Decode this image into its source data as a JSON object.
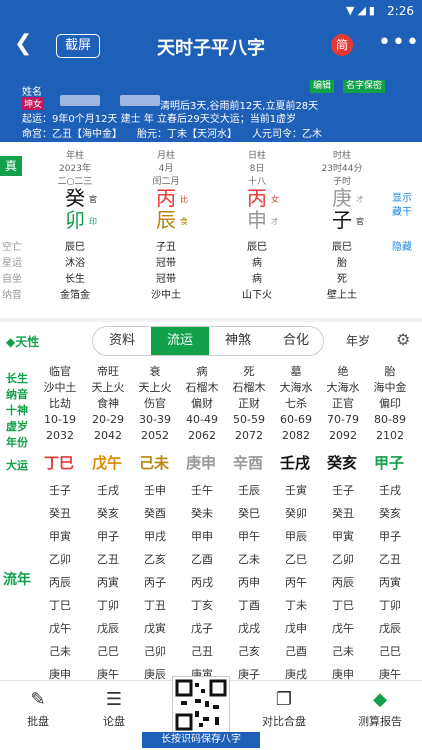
{
  "status": {
    "time": "2:26",
    "icons": "▼◢▮"
  },
  "appbar": {
    "title": "天时子平八字",
    "screenshot_btn": "截屏",
    "simplified_btn": "简",
    "more": "•••",
    "back": "❮"
  },
  "info": {
    "name_label": "姓名",
    "gender_badge": "坤女",
    "line1_right": "清明后3天,谷雨前12天,立夏前28天",
    "edit_btn": "编辑",
    "privacy_btn": "名字保密",
    "line2": "起运：9年0个月12天 建士 年 立春后29天交大运；当前1虚岁",
    "line3": "命宫：乙丑【海中金】　　胎元：丁未【天河水】　　人元司令：乙木"
  },
  "pillars": {
    "zhen": "真",
    "cols": [
      {
        "head": "年柱",
        "sub1": "2023年",
        "sub2": "二○二三",
        "gan": "癸",
        "gan_tag": "官",
        "gan_color": "#111111",
        "zhi": "卯",
        "zhi_tag": "印",
        "zhi_color": "#12a04a"
      },
      {
        "head": "月柱",
        "sub1": "4月",
        "sub2": "闰二月",
        "gan": "丙",
        "gan_tag": "比",
        "gan_color": "#e53935",
        "zhi": "辰",
        "zhi_tag": "食",
        "zhi_color": "#b8860b"
      },
      {
        "head": "日柱",
        "sub1": "8日",
        "sub2": "十八",
        "gan": "丙",
        "gan_tag": "女",
        "gan_color": "#e53935",
        "zhi": "申",
        "zhi_tag": "才",
        "zhi_color": "#999999"
      },
      {
        "head": "时柱",
        "sub1": "23时44分",
        "sub2": "子时",
        "gan": "庚",
        "gan_tag": "才",
        "gan_color": "#999999",
        "zhi": "子",
        "zhi_tag": "官",
        "zhi_color": "#111111"
      }
    ],
    "side_show": "显示藏干",
    "side_hide": "隐藏",
    "rows": [
      {
        "label": "空亡",
        "vals": [
          "辰巳",
          "子丑",
          "辰巳",
          "辰巳"
        ]
      },
      {
        "label": "星运",
        "vals": [
          "沐浴",
          "冠带",
          "病",
          "胎"
        ]
      },
      {
        "label": "自坐",
        "vals": [
          "长生",
          "冠带",
          "病",
          "死"
        ]
      },
      {
        "label": "纳音",
        "vals": [
          "金箔金",
          "沙中土",
          "山下火",
          "壁上土"
        ]
      }
    ]
  },
  "tabs": {
    "tianxing": "◆天性",
    "items": [
      "资料",
      "流运",
      "神煞",
      "合化"
    ],
    "active": 1,
    "nianshui": "年岁",
    "gear": "⚙"
  },
  "dayun": {
    "left_labels": [
      "长生",
      "纳音",
      "十神",
      "虚岁",
      "年份"
    ],
    "dayun_label": "大运",
    "cols": [
      {
        "zs": "临官",
        "ny": "沙中土",
        "ss": "比劫",
        "age": "10-19",
        "year": "2032",
        "yun": "丁巳",
        "color": "#e53935"
      },
      {
        "zs": "帝旺",
        "ny": "天上火",
        "ss": "食神",
        "age": "20-29",
        "year": "2042",
        "yun": "戊午",
        "color": "#d98b00"
      },
      {
        "zs": "衰",
        "ny": "天上火",
        "ss": "伤官",
        "age": "30-39",
        "year": "2052",
        "yun": "己未",
        "color": "#b8860b"
      },
      {
        "zs": "病",
        "ny": "石榴木",
        "ss": "偏财",
        "age": "40-49",
        "year": "2062",
        "yun": "庚申",
        "color": "#999999"
      },
      {
        "zs": "死",
        "ny": "石榴木",
        "ss": "正财",
        "age": "50-59",
        "year": "2072",
        "yun": "辛酉",
        "color": "#999999"
      },
      {
        "zs": "墓",
        "ny": "大海水",
        "ss": "七杀",
        "age": "60-69",
        "year": "2082",
        "yun": "壬戌",
        "color": "#111111"
      },
      {
        "zs": "绝",
        "ny": "大海水",
        "ss": "正官",
        "age": "70-79",
        "year": "2092",
        "yun": "癸亥",
        "color": "#111111"
      },
      {
        "zs": "胎",
        "ny": "海中金",
        "ss": "偏印",
        "age": "80-89",
        "year": "2102",
        "yun": "甲子",
        "color": "#12a04a"
      }
    ]
  },
  "liunian": {
    "label": "流年",
    "rows": [
      [
        "壬子",
        "壬戌",
        "壬申",
        "壬午",
        "壬辰",
        "壬寅",
        "壬子",
        "壬戌"
      ],
      [
        "癸丑",
        "癸亥",
        "癸酉",
        "癸未",
        "癸巳",
        "癸卯",
        "癸丑",
        "癸亥"
      ],
      [
        "甲寅",
        "甲子",
        "甲戌",
        "甲申",
        "甲午",
        "甲辰",
        "甲寅",
        "甲子"
      ],
      [
        "乙卯",
        "乙丑",
        "乙亥",
        "乙酉",
        "乙未",
        "乙巳",
        "乙卯",
        "乙丑"
      ],
      [
        "丙辰",
        "丙寅",
        "丙子",
        "丙戌",
        "丙申",
        "丙午",
        "丙辰",
        "丙寅"
      ],
      [
        "丁巳",
        "丁卯",
        "丁丑",
        "丁亥",
        "丁酉",
        "丁未",
        "丁巳",
        "丁卯"
      ],
      [
        "戊午",
        "戊辰",
        "戊寅",
        "戊子",
        "戊戌",
        "戊申",
        "戊午",
        "戊辰"
      ],
      [
        "己未",
        "己巳",
        "己卯",
        "己丑",
        "己亥",
        "己酉",
        "己未",
        "己巳"
      ],
      [
        "庚申",
        "庚午",
        "庚辰",
        "庚寅",
        "庚子",
        "庚戌",
        "庚申",
        "庚午"
      ]
    ]
  },
  "bottom": {
    "items": [
      {
        "label": "批盘",
        "icon": "✎"
      },
      {
        "label": "论盘",
        "icon": "☰"
      },
      {
        "label": "对比合盘",
        "icon": "❐"
      },
      {
        "label": "测算报告",
        "icon": "◆"
      }
    ],
    "qr_label": "长按识码保存八字"
  }
}
